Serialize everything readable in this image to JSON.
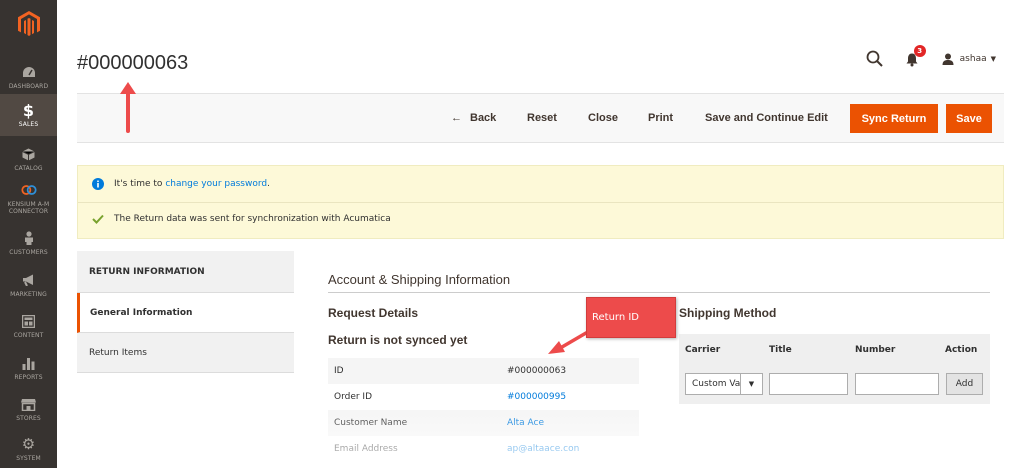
{
  "sidebar": {
    "items": [
      {
        "label": "DASHBOARD",
        "icon": "dashboard-icon"
      },
      {
        "label": "SALES",
        "icon": "dollar-icon"
      },
      {
        "label": "CATALOG",
        "icon": "cube-icon"
      },
      {
        "label": "KENSIUM A-M CONNECTOR",
        "icon": "connector-icon"
      },
      {
        "label": "CUSTOMERS",
        "icon": "person-icon"
      },
      {
        "label": "MARKETING",
        "icon": "megaphone-icon"
      },
      {
        "label": "CONTENT",
        "icon": "layout-icon"
      },
      {
        "label": "REPORTS",
        "icon": "bar-chart-icon"
      },
      {
        "label": "STORES",
        "icon": "storefront-icon"
      },
      {
        "label": "SYSTEM",
        "icon": "gear-icon"
      }
    ],
    "active": "SALES"
  },
  "header": {
    "title": "#000000063",
    "notification_count": "3",
    "username": "ashaa"
  },
  "toolbar": {
    "back": "Back",
    "reset": "Reset",
    "close": "Close",
    "print": "Print",
    "save_continue": "Save and Continue Edit",
    "sync_return": "Sync Return",
    "save": "Save"
  },
  "messages": {
    "password_prefix": "It's time to ",
    "password_link": "change your password",
    "password_suffix": ".",
    "sync_message": "The Return data was sent for synchronization with Acumatica"
  },
  "tabs": {
    "title": "RETURN INFORMATION",
    "items": [
      "General Information",
      "Return Items"
    ]
  },
  "main": {
    "section_title": "Account & Shipping Information",
    "request_details": "Request Details",
    "sync_status": "Return is not synced yet",
    "info": [
      {
        "key": "ID",
        "value": "#000000063"
      },
      {
        "key": "Order ID",
        "value": "#000000995"
      },
      {
        "key": "Customer Name",
        "value": "Alta Ace"
      },
      {
        "key": "Email Address",
        "value": "ap@altaace.con"
      }
    ]
  },
  "shipping": {
    "title": "Shipping Method",
    "headers": [
      "Carrier",
      "Title",
      "Number",
      "Action"
    ],
    "carrier_value": "Custom Value",
    "add_label": "Add"
  },
  "annotation": {
    "callout_text": "Return ID"
  },
  "colors": {
    "accent": "#eb5202",
    "sidebar": "#373330",
    "link": "#007bdb",
    "annotation": "#ed4b4b"
  }
}
